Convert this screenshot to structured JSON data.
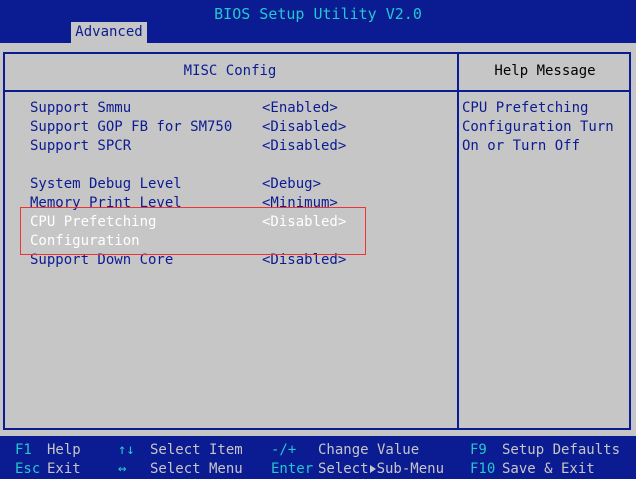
{
  "app_title": "BIOS Setup Utility V2.0",
  "tabs": [
    {
      "label": "Advanced"
    }
  ],
  "panel_title": "MISC Config",
  "help_title": "Help Message",
  "options": [
    {
      "label": "Support Smmu",
      "value": "<Enabled>"
    },
    {
      "label": "Support GOP FB for SM750",
      "value": "<Disabled>"
    },
    {
      "label": "Support SPCR",
      "value": "<Disabled>"
    },
    {
      "label": "System Debug Level",
      "value": "<Debug>"
    },
    {
      "label": "Memory Print Level",
      "value": "<Minimum>"
    },
    {
      "label_line1": "CPU Prefetching",
      "label_line2": "Configuration",
      "value": "<Disabled>",
      "selected": true
    },
    {
      "label": "Support Down Core",
      "value": "<Disabled>"
    }
  ],
  "help_lines": [
    "CPU Prefetching",
    "Configuration Turn",
    "On or Turn Off"
  ],
  "footer": {
    "f1_key": "F1",
    "f1_desc": "Help",
    "esc_key": "Esc",
    "esc_desc": "Exit",
    "updown_key": "↑↓",
    "updown_desc": "Select Item",
    "leftright_key": "↔",
    "leftright_desc": "Select Menu",
    "plusminus_key": "-/+",
    "plusminus_desc": "Change Value",
    "enter_key": "Enter",
    "enter_desc_a": "Select",
    "enter_desc_b": "Sub-Menu",
    "f9_key": "F9",
    "f9_desc": "Setup Defaults",
    "f10_key": "F10",
    "f10_desc": "Save & Exit"
  },
  "colors": {
    "background": "#0b1b92",
    "panel": "#c6c6c6",
    "accent_cyan": "#23c8cf",
    "selection_border": "#e33"
  }
}
